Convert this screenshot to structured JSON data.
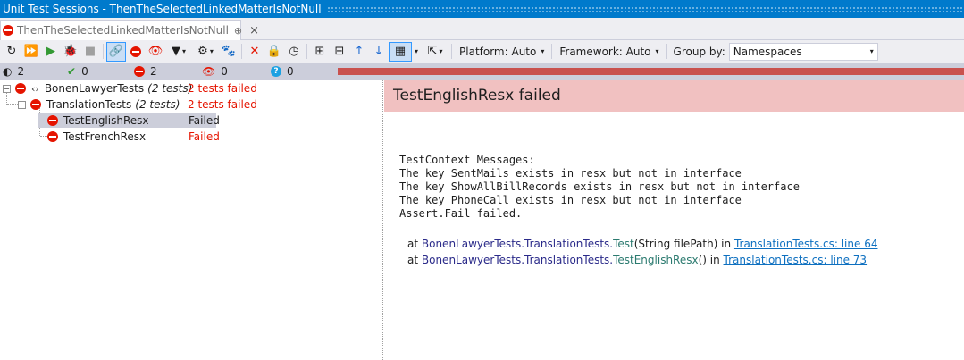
{
  "window": {
    "title": "Unit Test Sessions - ThenTheSelectedLinkedMatterIsNotNull"
  },
  "tab": {
    "label": "ThenTheSelectedLinkedMatterIsNotNull",
    "pin_glyph": "⊕",
    "close_glyph": "×"
  },
  "toolbar": {
    "buttons": [
      {
        "name": "refresh-icon",
        "glyph": "↻"
      },
      {
        "name": "run-all-icon",
        "glyph": "⏩"
      },
      {
        "name": "run-icon",
        "glyph": "▶"
      },
      {
        "name": "debug-icon",
        "glyph": "🐞"
      },
      {
        "name": "stop-icon",
        "glyph": "■"
      },
      {
        "name": "link-icon",
        "glyph": "🔗"
      },
      {
        "name": "failed-filter-icon",
        "glyph": "⛔"
      },
      {
        "name": "ignored-filter-icon",
        "glyph": "👁"
      },
      {
        "name": "filter-icon",
        "glyph": "▼"
      },
      {
        "name": "group-icon",
        "glyph": "⚙"
      },
      {
        "name": "paw-icon",
        "glyph": "🐾"
      },
      {
        "name": "remove-icon",
        "glyph": "✕"
      },
      {
        "name": "lock-icon",
        "glyph": "🔒"
      },
      {
        "name": "clock-icon",
        "glyph": "◷"
      },
      {
        "name": "expand-all-icon",
        "glyph": "⊞"
      },
      {
        "name": "collapse-all-icon",
        "glyph": "⊟"
      },
      {
        "name": "arrow-up-icon",
        "glyph": "↑"
      },
      {
        "name": "arrow-down-icon",
        "glyph": "↓"
      },
      {
        "name": "layout-icon",
        "glyph": "▦"
      },
      {
        "name": "export-icon",
        "glyph": "⇱"
      }
    ],
    "platform_label": "Platform: Auto",
    "framework_label": "Framework: Auto",
    "groupby_label": "Group by:",
    "groupby_value": "Namespaces",
    "caret": "▾"
  },
  "status": {
    "total": "2",
    "passed": "0",
    "failed": "2",
    "ignored": "0",
    "unknown": "0",
    "passed_icon": "✔",
    "ignored_icon": "👁",
    "total_icon": "◐",
    "unknown_icon": "?",
    "progress_failed_fraction": 1.0,
    "colors": {
      "failed": "#c9514e",
      "passed": "#339933"
    }
  },
  "tree": {
    "expander_collapse": "−",
    "namespace_icon": "‹›",
    "nodes": [
      {
        "name": "BonenLawyerTests",
        "count": "(2 tests)",
        "status": "2 tests failed"
      },
      {
        "name": "TranslationTests",
        "count": "(2 tests)",
        "status": "2 tests failed"
      },
      {
        "name": "TestEnglishResx",
        "count": "",
        "status": "Failed"
      },
      {
        "name": "TestFrenchResx",
        "count": "",
        "status": "Failed"
      }
    ]
  },
  "detail": {
    "heading": "TestEnglishResx failed",
    "messages": [
      "TestContext Messages:",
      "The key SentMails exists in resx but not in interface",
      "The key ShowAllBillRecords exists in resx but not in interface",
      "The key PhoneCall exists in resx but not in interface",
      "Assert.Fail failed."
    ],
    "stack": [
      {
        "at": "at ",
        "cls": "BonenLawyerTests.TranslationTests.",
        "method": "Test",
        "args": "(String filePath) in ",
        "link": "TranslationTests.cs: line 64"
      },
      {
        "at": "at ",
        "cls": "BonenLawyerTests.TranslationTests.",
        "method": "TestEnglishResx",
        "args": "() in ",
        "link": "TranslationTests.cs: line 73"
      }
    ]
  }
}
